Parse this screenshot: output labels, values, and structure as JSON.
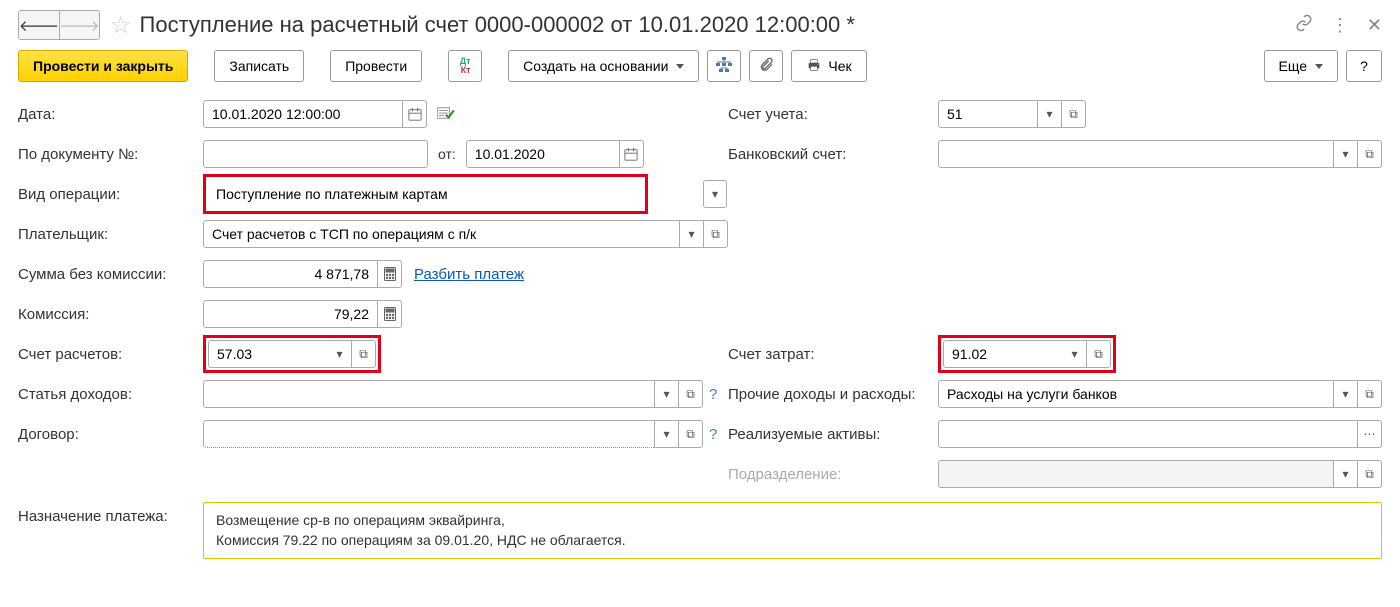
{
  "title": "Поступление на расчетный счет 0000-000002 от 10.01.2020 12:00:00 *",
  "toolbar": {
    "save_close": "Провести и закрыть",
    "write": "Записать",
    "post": "Провести",
    "create_based": "Создать на основании",
    "receipt": "Чек",
    "more": "Еще",
    "help": "?"
  },
  "left": {
    "date_lbl": "Дата:",
    "date_val": "10.01.2020 12:00:00",
    "docnum_lbl": "По документу №:",
    "docnum_val": "",
    "docdate_lbl": "от:",
    "docdate_val": "10.01.2020",
    "optype_lbl": "Вид операции:",
    "optype_val": "Поступление по платежным картам",
    "payer_lbl": "Плательщик:",
    "payer_val": "Счет расчетов с ТСП по операциям с п/к",
    "sum_nocom_lbl": "Сумма без комиссии:",
    "sum_nocom_val": "4 871,78",
    "split_link": "Разбить платеж",
    "commission_lbl": "Комиссия:",
    "commission_val": "79,22",
    "settle_lbl": "Счет расчетов:",
    "settle_val": "57.03",
    "income_lbl": "Статья доходов:",
    "income_val": "",
    "contract_lbl": "Договор:",
    "contract_val": ""
  },
  "right": {
    "account_lbl": "Счет учета:",
    "account_val": "51",
    "bank_lbl": "Банковский счет:",
    "bank_val": "",
    "cost_lbl": "Счет затрат:",
    "cost_val": "91.02",
    "other_lbl": "Прочие доходы и расходы:",
    "other_val": "Расходы на услуги банков",
    "assets_lbl": "Реализуемые активы:",
    "assets_val": "",
    "division_lbl": "Подразделение:",
    "division_val": ""
  },
  "purpose": {
    "lbl": "Назначение платежа:",
    "line1": "Возмещение ср-в по операциям эквайринга,",
    "line2": "Комиссия 79.22 по операциям за 09.01.20, НДС не облагается."
  }
}
